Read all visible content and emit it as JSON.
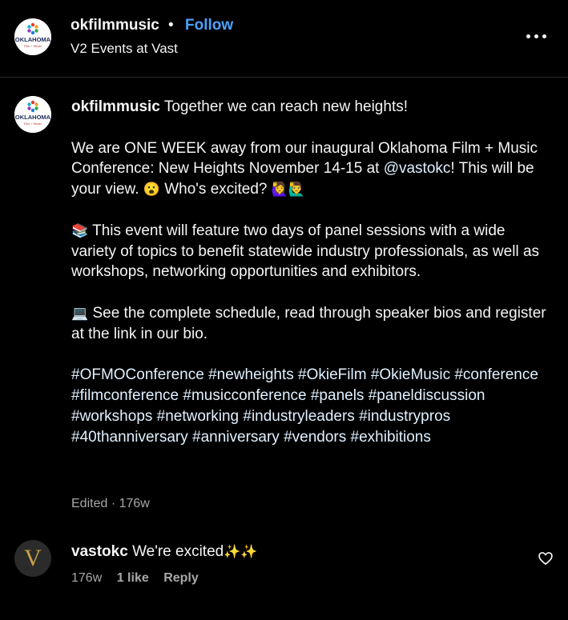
{
  "header": {
    "username": "okfilmmusic",
    "separator": "•",
    "follow_label": "Follow",
    "location": "V2 Events at Vast",
    "more_icon": "more-horizontal-icon"
  },
  "avatar": {
    "logo_text": "OKLAHOMA",
    "logo_sub": "Film + Music"
  },
  "caption": {
    "username": "okfilmmusic",
    "line1": "Together we can reach new heights!",
    "para2_a": "We are ONE WEEK away from our inaugural Oklahoma Film + Music Conference: New Heights November 14-15 at ",
    "para2_mention": "@vastokc",
    "para2_b": "! This will be your view. ",
    "para2_emoji1": "😮",
    "para2_c": " Who's excited? ",
    "para2_emoji2": "🙋‍♀️🙋‍♂️",
    "para3_emoji": "📚",
    "para3": " This event will feature two days of panel sessions with a wide variety of topics to benefit statewide industry professionals, as well as workshops, networking opportunities and exhibitors.",
    "para4_emoji": "💻",
    "para4": " See the complete schedule, read through speaker bios and register at the link in our bio.",
    "hashtags": "#OFMOConference #newheights #OkieFilm #OkieMusic #conference #filmconference #musicconference #panels #paneldiscussion #workshops #networking #industryleaders #industrypros #40thanniversary #anniversary #vendors #exhibitions",
    "meta": "Edited · 176w"
  },
  "comment": {
    "avatar_letter": "V",
    "username": "vastokc",
    "text": "We're excited",
    "sparkles": "✨✨",
    "time": "176w",
    "likes": "1 like",
    "reply_label": "Reply",
    "heart_icon": "heart-outline-icon"
  },
  "colors": {
    "background": "#000000",
    "text": "#f5f5f5",
    "follow": "#4aa3ff",
    "link": "#e0f1ff",
    "muted": "#a8a8a8",
    "divider": "#262626"
  }
}
